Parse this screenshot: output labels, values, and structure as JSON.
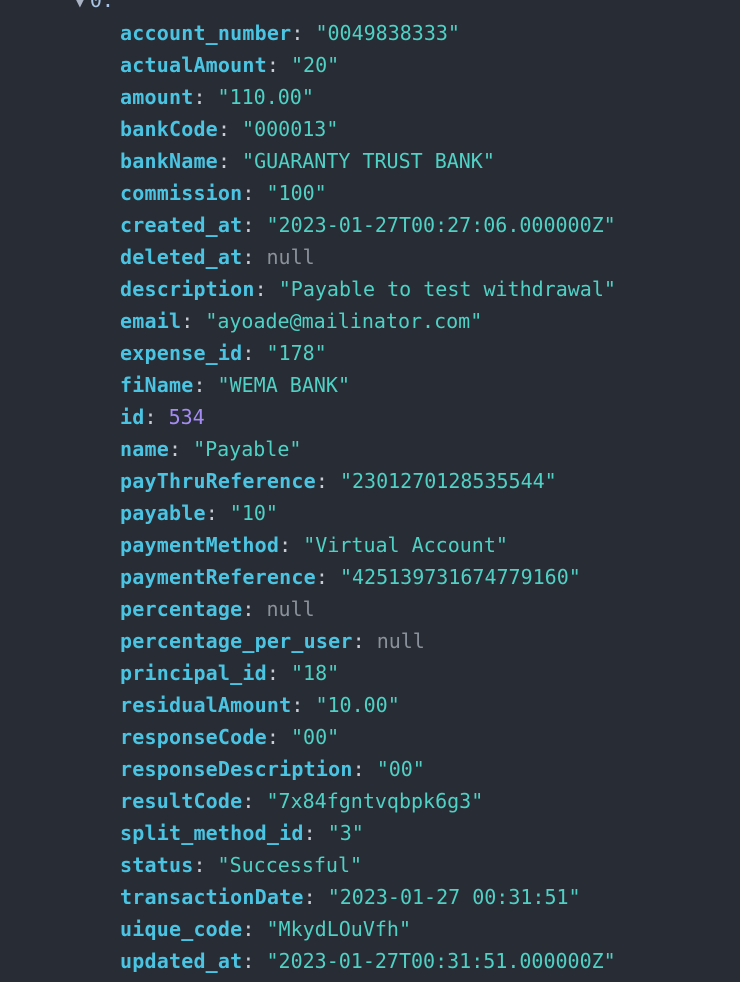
{
  "node": {
    "label": "0:"
  },
  "properties": [
    {
      "key": "account_number",
      "display": "\"0049838333\"",
      "type": "string"
    },
    {
      "key": "actualAmount",
      "display": "\"20\"",
      "type": "string"
    },
    {
      "key": "amount",
      "display": "\"110.00\"",
      "type": "string"
    },
    {
      "key": "bankCode",
      "display": "\"000013\"",
      "type": "string"
    },
    {
      "key": "bankName",
      "display": "\"GUARANTY TRUST BANK\"",
      "type": "string"
    },
    {
      "key": "commission",
      "display": "\"100\"",
      "type": "string"
    },
    {
      "key": "created_at",
      "display": "\"2023-01-27T00:27:06.000000Z\"",
      "type": "string"
    },
    {
      "key": "deleted_at",
      "display": "null",
      "type": "null"
    },
    {
      "key": "description",
      "display": "\"Payable to test withdrawal\"",
      "type": "string"
    },
    {
      "key": "email",
      "display": "\"ayoade@mailinator.com\"",
      "type": "string"
    },
    {
      "key": "expense_id",
      "display": "\"178\"",
      "type": "string"
    },
    {
      "key": "fiName",
      "display": "\"WEMA BANK\"",
      "type": "string"
    },
    {
      "key": "id",
      "display": "534",
      "type": "number"
    },
    {
      "key": "name",
      "display": "\"Payable\"",
      "type": "string"
    },
    {
      "key": "payThruReference",
      "display": "\"2301270128535544\"",
      "type": "string"
    },
    {
      "key": "payable",
      "display": "\"10\"",
      "type": "string"
    },
    {
      "key": "paymentMethod",
      "display": "\"Virtual Account\"",
      "type": "string"
    },
    {
      "key": "paymentReference",
      "display": "\"425139731674779160\"",
      "type": "string"
    },
    {
      "key": "percentage",
      "display": "null",
      "type": "null"
    },
    {
      "key": "percentage_per_user",
      "display": "null",
      "type": "null"
    },
    {
      "key": "principal_id",
      "display": "\"18\"",
      "type": "string"
    },
    {
      "key": "residualAmount",
      "display": "\"10.00\"",
      "type": "string"
    },
    {
      "key": "responseCode",
      "display": "\"00\"",
      "type": "string"
    },
    {
      "key": "responseDescription",
      "display": "\"00\"",
      "type": "string"
    },
    {
      "key": "resultCode",
      "display": "\"7x84fgntvqbpk6g3\"",
      "type": "string"
    },
    {
      "key": "split_method_id",
      "display": "\"3\"",
      "type": "string"
    },
    {
      "key": "status",
      "display": "\"Successful\"",
      "type": "string"
    },
    {
      "key": "transactionDate",
      "display": "\"2023-01-27 00:31:51\"",
      "type": "string"
    },
    {
      "key": "uique_code",
      "display": "\"MkydLOuVfh\"",
      "type": "string"
    },
    {
      "key": "updated_at",
      "display": "\"2023-01-27T00:31:51.000000Z\"",
      "type": "string"
    }
  ],
  "colors": {
    "background": "#282c34",
    "key": "#4ac4e2",
    "string": "#4fd1c5",
    "null": "#8b919a",
    "number": "#a58cf5"
  }
}
